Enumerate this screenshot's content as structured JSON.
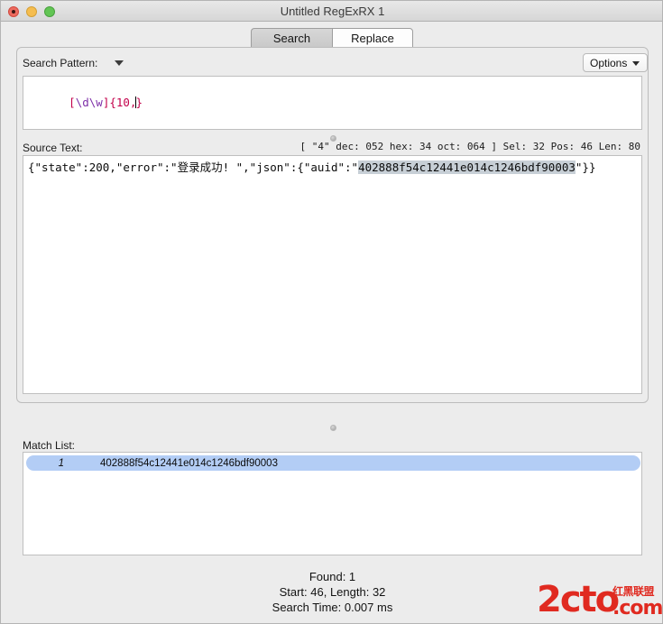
{
  "window": {
    "title": "Untitled RegExRX 1",
    "controls": {
      "close": "close-button",
      "minimize": "minimize-button",
      "maximize": "maximize-button"
    }
  },
  "tabs": [
    {
      "label": "Search",
      "active": true
    },
    {
      "label": "Replace",
      "active": false
    }
  ],
  "search_pattern": {
    "label": "Search Pattern:",
    "value": "[\\d\\w]{10,}",
    "tokens": [
      {
        "text": "[",
        "kind": "class"
      },
      {
        "text": "\\d",
        "kind": "escape"
      },
      {
        "text": "\\w",
        "kind": "escape"
      },
      {
        "text": "]",
        "kind": "class"
      },
      {
        "text": "{10,",
        "kind": "quant"
      },
      {
        "text": "}",
        "kind": "quant"
      }
    ],
    "dropdown_icon": "chevron-down-icon"
  },
  "options": {
    "label": "Options",
    "icon": "chevron-down-icon"
  },
  "source_text": {
    "label": "Source Text:",
    "prefix": "{\"state\":200,\"error\":\"登录成功! \",\"json\":{\"auid\":\"",
    "selected": "402888f54c12441e014c1246bdf90003",
    "suffix": "\"}}",
    "full": "{\"state\":200,\"error\":\"登录成功! \",\"json\":{\"auid\":\"402888f54c12441e014c1246bdf90003\"}}"
  },
  "char_info": "[ \"4\" dec: 052 hex: 34 oct: 064 ] Sel: 32 Pos: 46 Len: 80",
  "match_list": {
    "label": "Match List:",
    "rows": [
      {
        "index": "1",
        "value": "402888f54c12441e014c1246bdf90003"
      }
    ]
  },
  "footer": {
    "found": "Found: 1",
    "start_length": "Start: 46, Length: 32",
    "search_time": "Search Time: 0.007 ms"
  },
  "watermark": {
    "main": "2cto",
    "cn": "红黑联盟",
    "dotcom": ".com"
  },
  "colors": {
    "accent_selection": "#b3cdf5",
    "text_selection": "#c7cfd6",
    "watermark_red": "#e02a20",
    "regex_class": "#c3004a",
    "regex_escape": "#7d2fa8"
  }
}
